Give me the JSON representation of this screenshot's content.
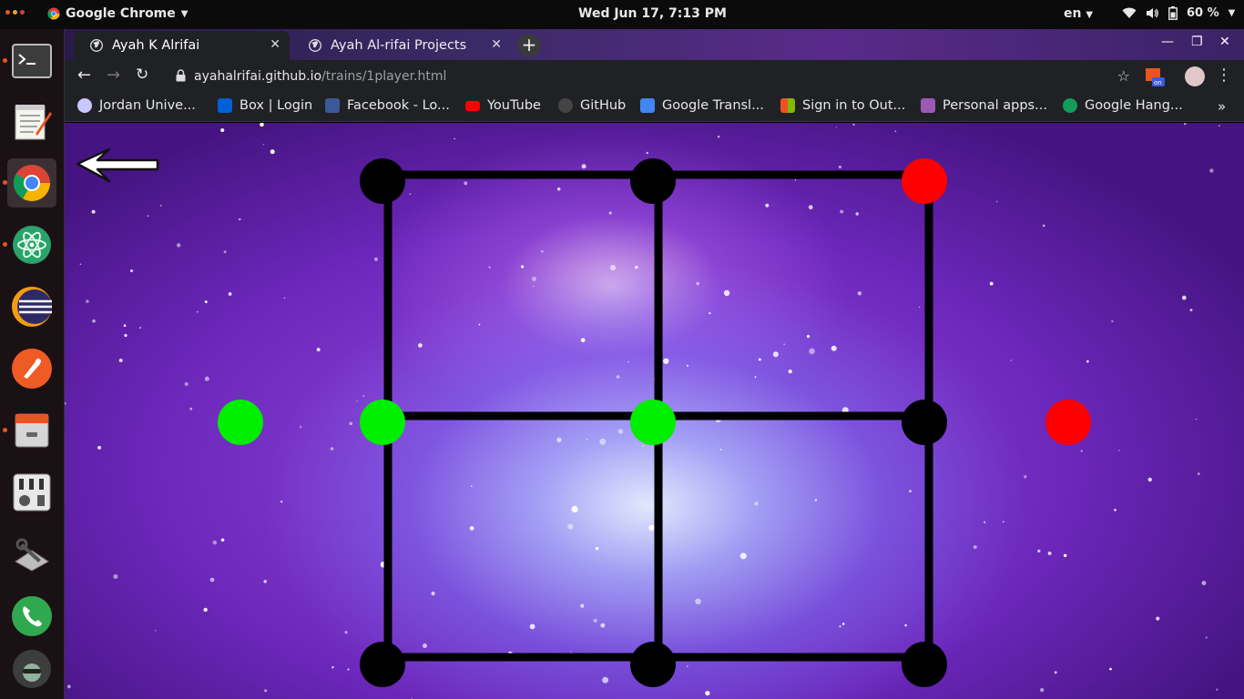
{
  "system": {
    "app_name": "Google Chrome",
    "clock": "Wed Jun 17,  7:13 PM",
    "lang": "en",
    "battery": "60 %"
  },
  "dock": {
    "items": [
      "terminal-icon",
      "text-editor-icon",
      "chrome-icon",
      "atom-icon",
      "eclipse-icon",
      "postman-icon",
      "file-cabinet-icon",
      "mixer-icon",
      "system-tools-icon",
      "phone-icon",
      "avatar-icon"
    ]
  },
  "tabs": [
    {
      "label": "Ayah K Alrifai",
      "active": true
    },
    {
      "label": "Ayah Al-rifai Projects",
      "active": false
    }
  ],
  "address": {
    "host": "ayahalrifai.github.io",
    "path": "/trains/1player.html"
  },
  "bookmarks": [
    {
      "label": "Jordan Unive...",
      "color": "#c8c8ff"
    },
    {
      "label": "Box | Login",
      "color": "#0061d5"
    },
    {
      "label": "Facebook - Lo...",
      "color": "#3b5998"
    },
    {
      "label": "YouTube",
      "color": "#ff0000"
    },
    {
      "label": "GitHub",
      "color": "#444444"
    },
    {
      "label": "Google Transl...",
      "color": "#4285f4"
    },
    {
      "label": "Sign in to Out...",
      "color": "#f25022"
    },
    {
      "label": "Personal apps...",
      "color": "#9b59b6"
    },
    {
      "label": "Google Hang...",
      "color": "#0f9d58"
    }
  ],
  "game": {
    "colors": {
      "line": "#000000",
      "empty": "#000000",
      "player": "#00ee00",
      "opponent": "#ff0000"
    },
    "pieces": [
      {
        "id": "tl",
        "state": "empty"
      },
      {
        "id": "tm",
        "state": "empty"
      },
      {
        "id": "tr",
        "state": "opponent"
      },
      {
        "id": "ml",
        "state": "player"
      },
      {
        "id": "mm",
        "state": "player"
      },
      {
        "id": "mr",
        "state": "empty"
      },
      {
        "id": "bl",
        "state": "empty"
      },
      {
        "id": "bm",
        "state": "empty"
      },
      {
        "id": "br",
        "state": "empty"
      },
      {
        "id": "side-left",
        "state": "player"
      },
      {
        "id": "side-right",
        "state": "opponent"
      }
    ]
  }
}
